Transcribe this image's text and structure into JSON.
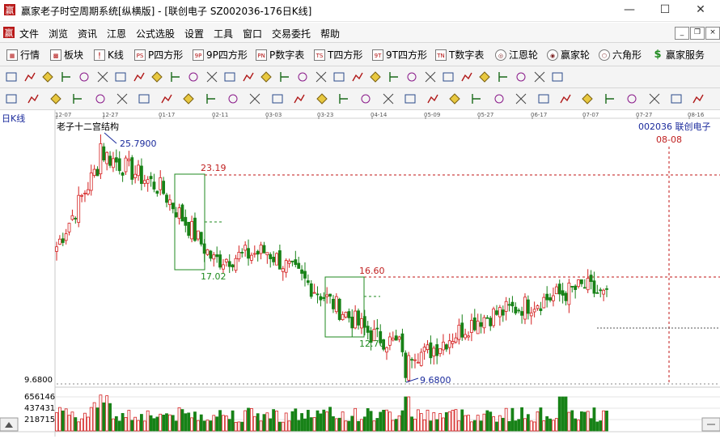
{
  "window": {
    "title": "赢家老子时空周期系统[纵横版] - [联创电子  SZ002036-176日K线]",
    "minimize": "—",
    "maximize": "☐",
    "close": "✕"
  },
  "menu": {
    "items": [
      "文件",
      "浏览",
      "资讯",
      "江恩",
      "公式选股",
      "设置",
      "工具",
      "窗口",
      "交易委托",
      "帮助"
    ],
    "mdi": [
      "_",
      "❐",
      "×"
    ]
  },
  "toolbar1": {
    "items": [
      {
        "label": "行情",
        "icon": "table-icon",
        "mark": "▦"
      },
      {
        "label": "板块",
        "icon": "blocks-icon",
        "mark": "▩"
      },
      {
        "label": "K线",
        "icon": "candle-icon",
        "mark": "╿"
      },
      {
        "label": "P四方形",
        "icon": "p-square-icon",
        "mark": "PS"
      },
      {
        "label": "9P四方形",
        "icon": "9p-square-icon",
        "mark": "9P"
      },
      {
        "label": "P数字表",
        "icon": "p-number-table-icon",
        "mark": "PN"
      },
      {
        "label": "T四方形",
        "icon": "t-square-icon",
        "mark": "TS"
      },
      {
        "label": "9T四方形",
        "icon": "9t-square-icon",
        "mark": "9T"
      },
      {
        "label": "T数字表",
        "icon": "t-number-table-icon",
        "mark": "TN"
      },
      {
        "label": "江恩轮",
        "icon": "gann-wheel-icon",
        "mark": "◎"
      },
      {
        "label": "赢家轮",
        "icon": "winner-wheel-icon",
        "mark": "◉"
      },
      {
        "label": "六角形",
        "icon": "hexagon-icon",
        "mark": "⬡"
      },
      {
        "label": "赢家服务",
        "icon": "dollar-icon",
        "mark": "$"
      }
    ]
  },
  "chart": {
    "panel_label": "日K线",
    "indicator_name": "老子十二宫结构",
    "stock_label": "002036  联创电子",
    "date_marker": "08-08",
    "bottom_price_label": "9.6800",
    "volume_labels": [
      "656146",
      "437431",
      "218715"
    ],
    "x_ticks": [
      "12-07",
      "12-27",
      "01-17",
      "02-11",
      "03-03",
      "03-23",
      "04-14",
      "05-09",
      "05-27",
      "06-17",
      "07-07",
      "07-27",
      "08-16"
    ],
    "annotations": [
      {
        "text": "25.7900",
        "color": "#1a2a9c"
      },
      {
        "text": "23.19",
        "color": "#c02020"
      },
      {
        "text": "17.02",
        "color": "#1f8a1f"
      },
      {
        "text": "16.60",
        "color": "#c02020"
      },
      {
        "text": "12.70",
        "color": "#1f8a1f"
      },
      {
        "text": "9.6800",
        "color": "#1a2a9c"
      }
    ],
    "colors": {
      "up": "#d42020",
      "down": "#178217",
      "line_red": "#c01515",
      "box_green": "#1f8a1f",
      "info_blue": "#1a2a9c"
    }
  },
  "chart_data": {
    "type": "candlestick",
    "title": "老子十二宫结构",
    "x_ticks": [
      "12-07",
      "12-27",
      "01-17",
      "02-11",
      "03-03",
      "03-23",
      "04-14",
      "05-09",
      "05-27",
      "06-17",
      "07-07",
      "07-27",
      "08-16"
    ],
    "price_high": 25.79,
    "price_low": 9.68,
    "levels": [
      {
        "label": "23.19",
        "value": 23.19
      },
      {
        "label": "17.02",
        "value": 17.02
      },
      {
        "label": "16.60",
        "value": 16.6
      },
      {
        "label": "12.70",
        "value": 12.7
      }
    ],
    "close_anchors": [
      {
        "date": "12-07",
        "close": 18.5
      },
      {
        "date": "12-27",
        "close": 24.5
      },
      {
        "date": "01-17",
        "close": 22.3
      },
      {
        "date": "02-11",
        "close": 17.6
      },
      {
        "date": "03-03",
        "close": 18.2
      },
      {
        "date": "03-23",
        "close": 15.6
      },
      {
        "date": "04-14",
        "close": 12.8
      },
      {
        "date": "05-09",
        "close": 11.5
      },
      {
        "date": "05-27",
        "close": 13.8
      },
      {
        "date": "06-17",
        "close": 14.8
      },
      {
        "date": "07-07",
        "close": 15.9
      },
      {
        "date": "07-27",
        "close": 14.1
      }
    ],
    "volume_ticks": [
      218715,
      437431,
      656146
    ]
  }
}
